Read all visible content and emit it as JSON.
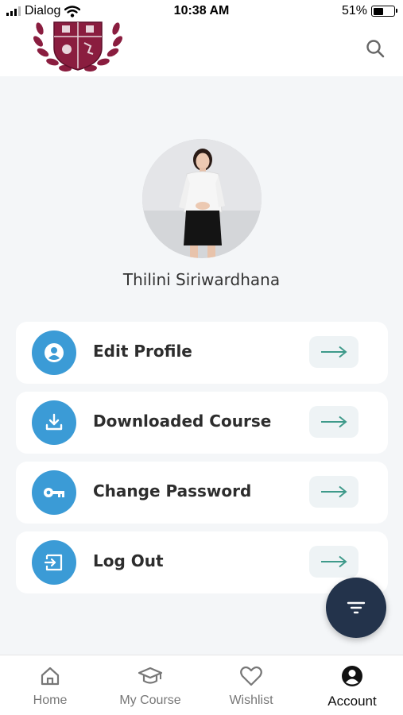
{
  "status_bar": {
    "carrier": "Dialog",
    "time": "10:38 AM",
    "battery": "51%",
    "battery_level": 0.51
  },
  "header": {
    "logo_icon": "crest-logo-icon",
    "search_icon": "search-icon"
  },
  "profile": {
    "name": "Thilini Siriwardhana",
    "avatar_icon": "profile-photo"
  },
  "menu": [
    {
      "label": "Edit Profile",
      "icon": "user-circle-icon",
      "arrow": "arrow-right-icon"
    },
    {
      "label": "Downloaded Course",
      "icon": "download-icon",
      "arrow": "arrow-right-icon"
    },
    {
      "label": "Change Password",
      "icon": "key-icon",
      "arrow": "arrow-right-icon"
    },
    {
      "label": "Log Out",
      "icon": "logout-icon",
      "arrow": "arrow-right-icon"
    }
  ],
  "fab": {
    "icon": "filter-icon"
  },
  "bottom_nav": [
    {
      "label": "Home",
      "icon": "home-icon",
      "active": false
    },
    {
      "label": "My Course",
      "icon": "graduation-cap-icon",
      "active": false
    },
    {
      "label": "Wishlist",
      "icon": "heart-icon",
      "active": false
    },
    {
      "label": "Account",
      "icon": "account-icon",
      "active": true
    }
  ],
  "colors": {
    "accent_blue": "#3b9bd6",
    "arrow_green": "#3e9a8a",
    "fab_navy": "#23334b",
    "crest_maroon": "#8a1d3f",
    "background": "#f4f6f8"
  }
}
